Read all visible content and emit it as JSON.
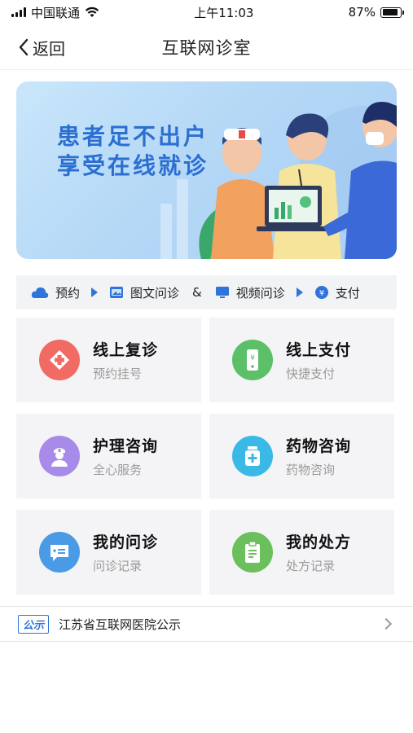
{
  "status": {
    "carrier": "中国联通",
    "time": "上午11:03",
    "battery": "87%",
    "battery_level": 0.87
  },
  "nav": {
    "back_label": "返回",
    "title": "互联网诊室"
  },
  "banner": {
    "line1": "患者足不出户",
    "line2": "享受在线就诊"
  },
  "flow": {
    "step1": "预约",
    "step2": "图文问诊",
    "connector": "&",
    "step3": "视频问诊",
    "step4": "支付"
  },
  "cards": [
    {
      "title": "线上复诊",
      "subtitle": "预约挂号",
      "color": "#f16a63"
    },
    {
      "title": "线上支付",
      "subtitle": "快捷支付",
      "color": "#5cc069"
    },
    {
      "title": "护理咨询",
      "subtitle": "全心服务",
      "color": "#a88be8"
    },
    {
      "title": "药物咨询",
      "subtitle": "药物咨询",
      "color": "#3bb9e6"
    },
    {
      "title": "我的问诊",
      "subtitle": "问诊记录",
      "color": "#4a9be5"
    },
    {
      "title": "我的处方",
      "subtitle": "处方记录",
      "color": "#6cbf5d"
    }
  ],
  "notice": {
    "tag": "公示",
    "text": "江苏省互联网医院公示"
  },
  "colors": {
    "accent": "#2f74d8",
    "banner_text": "#2b6fd0"
  }
}
